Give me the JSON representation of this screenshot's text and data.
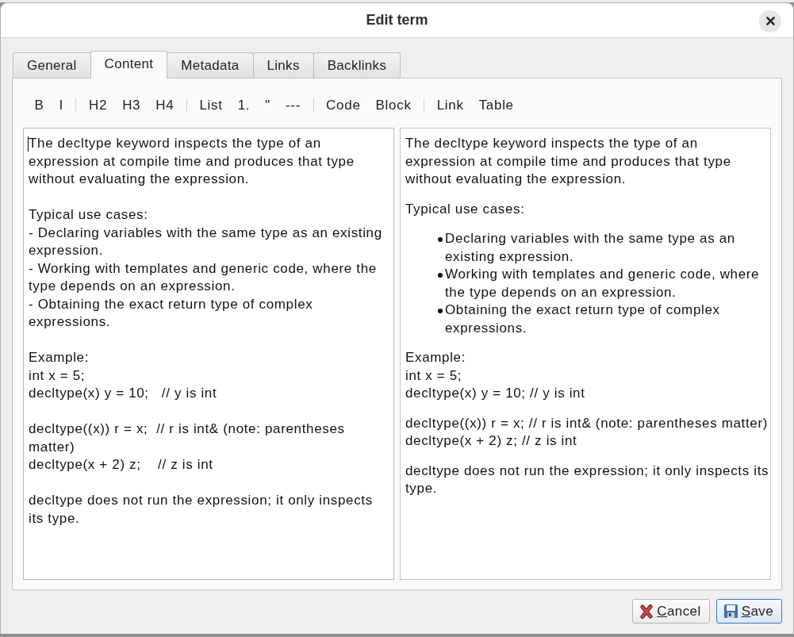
{
  "dialog": {
    "title": "Edit term"
  },
  "tabs": [
    {
      "label": "General",
      "selected": false
    },
    {
      "label": "Content",
      "selected": true
    },
    {
      "label": "Metadata",
      "selected": false
    },
    {
      "label": "Links",
      "selected": false
    },
    {
      "label": "Backlinks",
      "selected": false
    }
  ],
  "toolbar": {
    "groups": [
      [
        "B",
        "I"
      ],
      [
        "H2",
        "H3",
        "H4"
      ],
      [
        "List",
        "1.",
        "\"",
        "---"
      ],
      [
        "Code",
        "Block"
      ],
      [
        "Link",
        "Table"
      ]
    ]
  },
  "editor": {
    "focused": true,
    "blocks": [
      [
        "The decltype keyword inspects the type of an expression at compile time and produces that type without evaluating the expression."
      ],
      [
        "Typical use cases:",
        "- Declaring variables with the same type as an existing expression.",
        "- Working with templates and generic code, where the type depends on an expression.",
        "- Obtaining the exact return type of complex expressions."
      ],
      [
        "Example:",
        "int x = 5;",
        "decltype(x) y = 10;   // y is int"
      ],
      [
        "decltype((x)) r = x;  // r is int& (note: parentheses matter)",
        "decltype(x + 2) z;    // z is int"
      ],
      [
        "decltype does not run the expression; it only inspects its type."
      ]
    ]
  },
  "preview": {
    "blocks": [
      {
        "kind": "paragraph",
        "lines": [
          "The decltype keyword inspects the type of an expression at compile time and produces that type without evaluating the expression."
        ]
      },
      {
        "kind": "paragraph",
        "lines": [
          "Typical use cases:"
        ]
      },
      {
        "kind": "list",
        "items": [
          "Declaring variables with the same type as an existing expression.",
          "Working with templates and generic code, where the type depends on an expression.",
          "Obtaining the exact return type of complex expressions."
        ]
      },
      {
        "kind": "paragraph",
        "lines": [
          "Example:",
          "int x = 5;",
          "decltype(x) y = 10; // y is int"
        ]
      },
      {
        "kind": "paragraph",
        "lines": [
          "decltype((x)) r = x; // r is int& (note: parentheses matter)",
          "decltype(x + 2) z; // z is int"
        ]
      },
      {
        "kind": "paragraph",
        "lines": [
          "decltype does not run the expression; it only inspects its type."
        ]
      }
    ]
  },
  "buttons": [
    {
      "kind": "cancel",
      "label": "Cancel",
      "default": false
    },
    {
      "kind": "save",
      "label": "Save",
      "default": true
    }
  ]
}
